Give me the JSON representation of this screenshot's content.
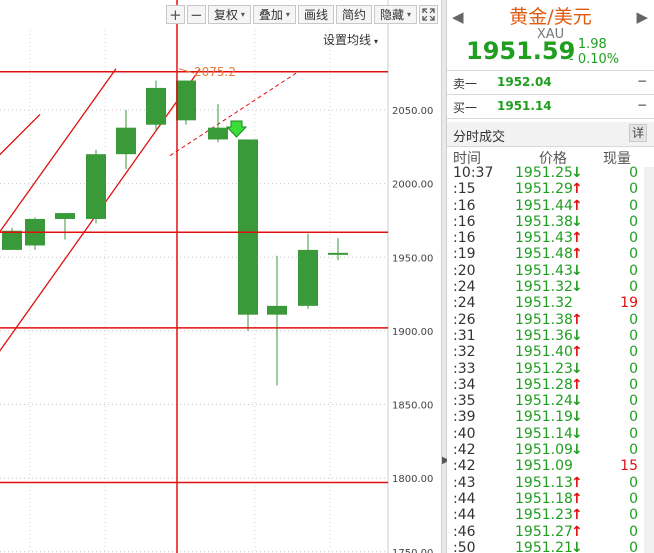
{
  "toolbar": {
    "zoom_in": "+",
    "zoom_out": "−",
    "adjust": "复权",
    "overlay": "叠加",
    "draw": "画线",
    "simple": "简约",
    "hide": "隐藏",
    "dropdown_arrow": "▾",
    "fullscreen_icon": "fullscreen-icon"
  },
  "ma_settings": "设置均线",
  "chart_data": {
    "type": "candlestick",
    "y_ticks": [
      "2050.00",
      "2000.00",
      "1950.00",
      "1900.00",
      "1850.00",
      "1800.00",
      "1750.00"
    ],
    "ylim": [
      1748,
      2078
    ],
    "annotation": "2075.2",
    "up_color": "#3a9a3a",
    "line_color": "#e01010",
    "candles": [
      {
        "o": 1955,
        "h": 1970,
        "l": 1955,
        "c": 1968
      },
      {
        "o": 1958,
        "h": 1977,
        "l": 1955,
        "c": 1976
      },
      {
        "o": 1976,
        "h": 1980,
        "l": 1962,
        "c": 1980
      },
      {
        "o": 1976,
        "h": 2023,
        "l": 1973,
        "c": 2020
      },
      {
        "o": 2020,
        "h": 2050,
        "l": 2010,
        "c": 2038
      },
      {
        "o": 2040,
        "h": 2070,
        "l": 2036,
        "c": 2065
      },
      {
        "o": 2043,
        "h": 2070,
        "l": 2040,
        "c": 2070
      },
      {
        "o": 2030,
        "h": 2054,
        "l": 2028,
        "c": 2038
      },
      {
        "o": 2030,
        "h": 2030,
        "l": 1900,
        "c": 1911
      },
      {
        "o": 1911,
        "h": 1951,
        "l": 1863,
        "c": 1917
      },
      {
        "o": 1917,
        "h": 1966,
        "l": 1915,
        "c": 1955
      },
      {
        "o": 1953,
        "h": 1963,
        "l": 1948,
        "c": 1953
      }
    ],
    "horizontal_lines": [
      2076,
      1967,
      1902,
      1797
    ]
  },
  "quote": {
    "name": "黄金/美元",
    "code": "XAU",
    "last": "1951.59",
    "change": "- 1.98",
    "change_pct": "- 0.10%",
    "prev_arrow": "◀",
    "next_arrow": "▶",
    "price_color": "#1f9e1f"
  },
  "book": {
    "ask_label": "卖一",
    "ask_price": "1952.04",
    "ask_vol": "−",
    "bid_label": "买一",
    "bid_price": "1951.14",
    "bid_vol": "−"
  },
  "ticks": {
    "title": "分时成交",
    "detail": "详",
    "col_time": "时间",
    "col_price": "价格",
    "col_vol": "现量",
    "rows": [
      {
        "time": "10:37",
        "price": "1951.25",
        "dir": "down",
        "vol": "0"
      },
      {
        "time": ":15",
        "price": "1951.29",
        "dir": "up",
        "vol": "0"
      },
      {
        "time": ":16",
        "price": "1951.44",
        "dir": "up",
        "vol": "0"
      },
      {
        "time": ":16",
        "price": "1951.38",
        "dir": "down",
        "vol": "0"
      },
      {
        "time": ":16",
        "price": "1951.43",
        "dir": "up",
        "vol": "0"
      },
      {
        "time": ":19",
        "price": "1951.48",
        "dir": "up",
        "vol": "0"
      },
      {
        "time": ":20",
        "price": "1951.43",
        "dir": "down",
        "vol": "0"
      },
      {
        "time": ":24",
        "price": "1951.32",
        "dir": "down",
        "vol": "0"
      },
      {
        "time": ":24",
        "price": "1951.32",
        "dir": "",
        "vol": "19"
      },
      {
        "time": ":26",
        "price": "1951.38",
        "dir": "up",
        "vol": "0"
      },
      {
        "time": ":31",
        "price": "1951.36",
        "dir": "down",
        "vol": "0"
      },
      {
        "time": ":32",
        "price": "1951.40",
        "dir": "up",
        "vol": "0"
      },
      {
        "time": ":33",
        "price": "1951.23",
        "dir": "down",
        "vol": "0"
      },
      {
        "time": ":34",
        "price": "1951.28",
        "dir": "up",
        "vol": "0"
      },
      {
        "time": ":35",
        "price": "1951.24",
        "dir": "down",
        "vol": "0"
      },
      {
        "time": ":39",
        "price": "1951.19",
        "dir": "down",
        "vol": "0"
      },
      {
        "time": ":40",
        "price": "1951.14",
        "dir": "down",
        "vol": "0"
      },
      {
        "time": ":42",
        "price": "1951.09",
        "dir": "down",
        "vol": "0"
      },
      {
        "time": ":42",
        "price": "1951.09",
        "dir": "",
        "vol": "15"
      },
      {
        "time": ":43",
        "price": "1951.13",
        "dir": "up",
        "vol": "0"
      },
      {
        "time": ":44",
        "price": "1951.18",
        "dir": "up",
        "vol": "0"
      },
      {
        "time": ":44",
        "price": "1951.23",
        "dir": "up",
        "vol": "0"
      },
      {
        "time": ":46",
        "price": "1951.27",
        "dir": "up",
        "vol": "0"
      },
      {
        "time": ":50",
        "price": "1951.21",
        "dir": "down",
        "vol": "0"
      }
    ]
  }
}
